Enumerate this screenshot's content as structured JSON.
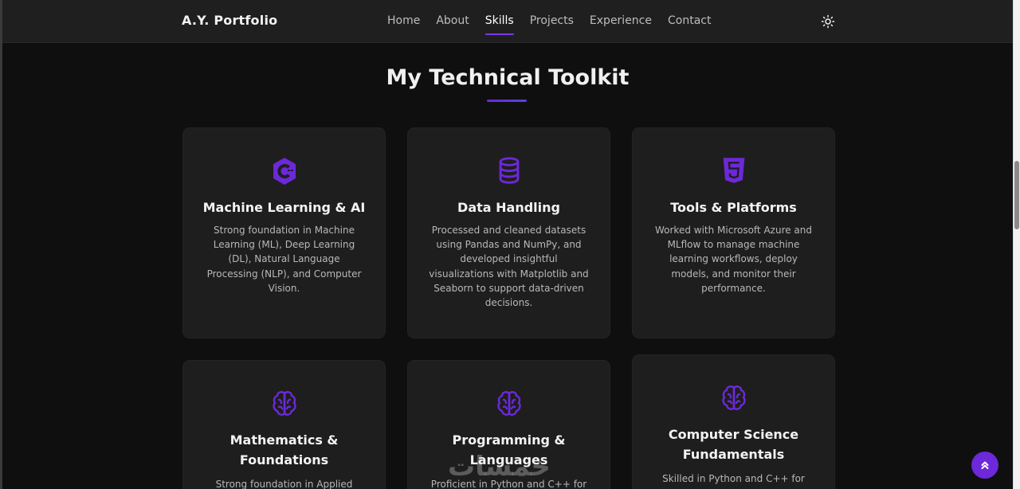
{
  "nav": {
    "brand": "A.Y. Portfolio",
    "links": [
      "Home",
      "About",
      "Skills",
      "Projects",
      "Experience",
      "Contact"
    ],
    "active": "Skills",
    "theme_icon": "sun-icon"
  },
  "section": {
    "title": "My Technical Toolkit"
  },
  "cards": [
    {
      "icon": "c-language-icon",
      "title": "Machine Learning & AI",
      "description": "Strong foundation in Machine Learning (ML), Deep Learning (DL), Natural Language Processing (NLP), and Computer Vision."
    },
    {
      "icon": "database-icon",
      "title": "Data Handling",
      "description": "Processed and cleaned datasets using Pandas and NumPy, and developed insightful visualizations with Matplotlib and Seaborn to support data-driven decisions."
    },
    {
      "icon": "html5-icon",
      "title": "Tools & Platforms",
      "description": "Worked with Microsoft Azure and MLflow to manage machine learning workflows, deploy models, and monitor their performance."
    },
    {
      "icon": "brain-icon",
      "title": "Mathematics & Foundations",
      "description": "Strong foundation in Applied"
    },
    {
      "icon": "brain-icon",
      "title": "Programming & Languages",
      "description": "Proficient in Python and C++ for"
    },
    {
      "icon": "brain-icon",
      "title": "Computer Science Fundamentals",
      "description": "Skilled in Python and C++ for"
    }
  ],
  "watermark": "خمسات",
  "colors": {
    "accent": "#6d28d9",
    "background": "#0f0f0f",
    "card": "#1e1e1e",
    "navbar": "#1f1f1f"
  }
}
